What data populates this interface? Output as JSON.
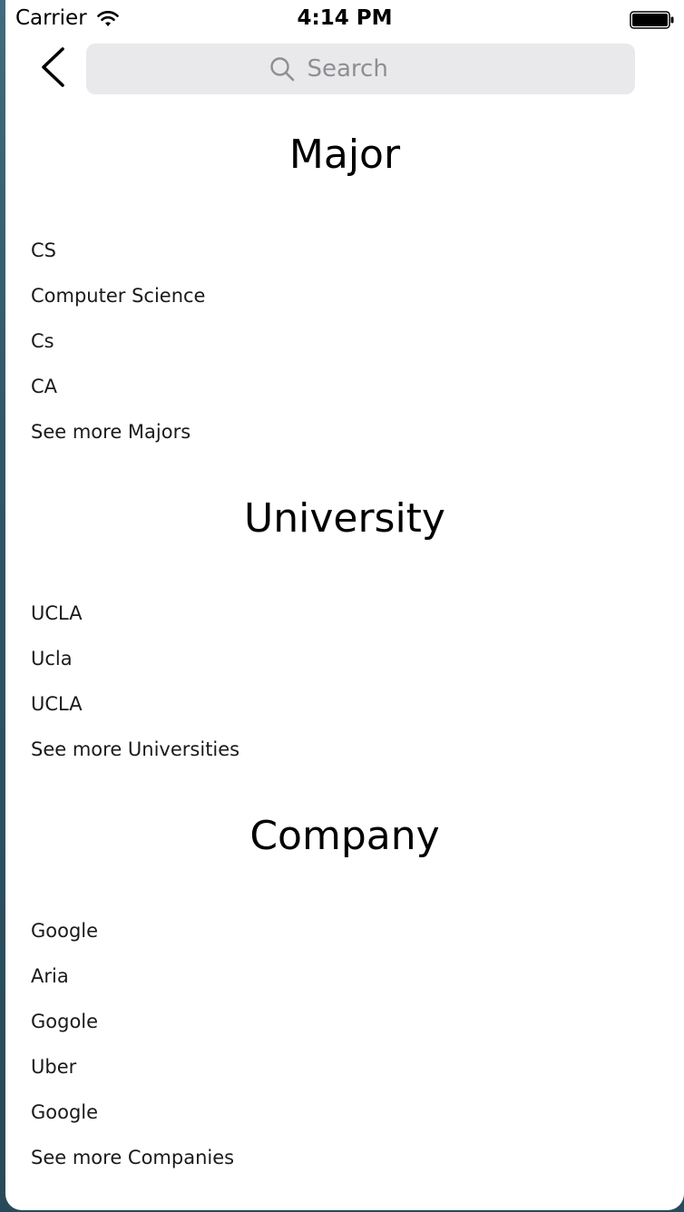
{
  "status_bar": {
    "carrier": "Carrier",
    "time": "4:14 PM"
  },
  "search": {
    "placeholder": "Search",
    "value": ""
  },
  "sections": {
    "major": {
      "title": "Major",
      "items": [
        "CS",
        "Computer Science",
        "Cs",
        "CA"
      ],
      "see_more": "See more Majors"
    },
    "university": {
      "title": "University",
      "items": [
        "UCLA",
        "Ucla",
        "UCLA"
      ],
      "see_more": "See more Universities"
    },
    "company": {
      "title": "Company",
      "items": [
        "Google",
        "Aria",
        "Gogole",
        "Uber",
        "Google"
      ],
      "see_more": "See more Companies"
    }
  },
  "icons": {
    "back": "chevron-left-icon",
    "search": "search-icon",
    "wifi": "wifi-icon",
    "battery": "battery-icon"
  },
  "colors": {
    "search_bar_bg": "#e9e9eb",
    "placeholder": "#8e8e93",
    "text": "#1a1a1a"
  }
}
